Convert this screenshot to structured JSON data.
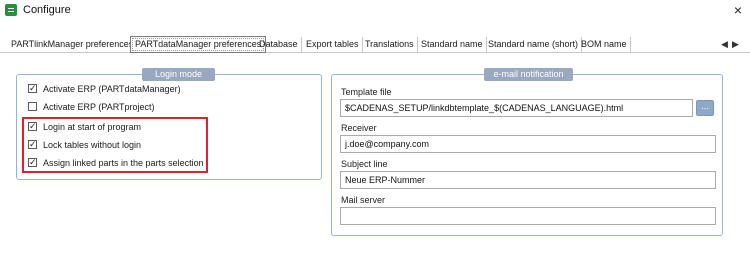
{
  "window": {
    "title": "Configure",
    "close_glyph": "×",
    "icon": "app-config-icon"
  },
  "tabs": [
    {
      "label": "PARTlinkManager preferences"
    },
    {
      "label": "PARTdataManager preferences",
      "active": true
    },
    {
      "label": "Database"
    },
    {
      "label": "Export tables"
    },
    {
      "label": "Translations"
    },
    {
      "label": "Standard name"
    },
    {
      "label": "Standard name (short)"
    },
    {
      "label": "BOM name"
    }
  ],
  "tab_nav": {
    "prev": "◀",
    "next": "▶"
  },
  "login_mode": {
    "caption": "Login mode",
    "items": [
      {
        "label": "Activate ERP (PARTdataManager)",
        "checked": true
      },
      {
        "label": "Activate ERP (PARTproject)",
        "checked": false
      },
      {
        "label": "Login at start of program",
        "checked": true
      },
      {
        "label": "Lock tables without login",
        "checked": true
      },
      {
        "label": "Assign linked parts in the parts selection",
        "checked": true
      }
    ]
  },
  "email": {
    "caption": "e-mail notification",
    "template_file_label": "Template file",
    "template_file_value": "$CADENAS_SETUP/linkdbtemplate_$(CADENAS_LANGUAGE).html",
    "browse_label": "...",
    "receiver_label": "Receiver",
    "receiver_value": "j.doe@company.com",
    "subject_label": "Subject line",
    "subject_value": "Neue ERP-Nummer",
    "mail_server_label": "Mail server",
    "mail_server_value": ""
  },
  "colors": {
    "highlight": "#e0232b",
    "caption_bg": "#97a8bf",
    "group_border": "#9ab3cf"
  },
  "check_glyph": "✓"
}
